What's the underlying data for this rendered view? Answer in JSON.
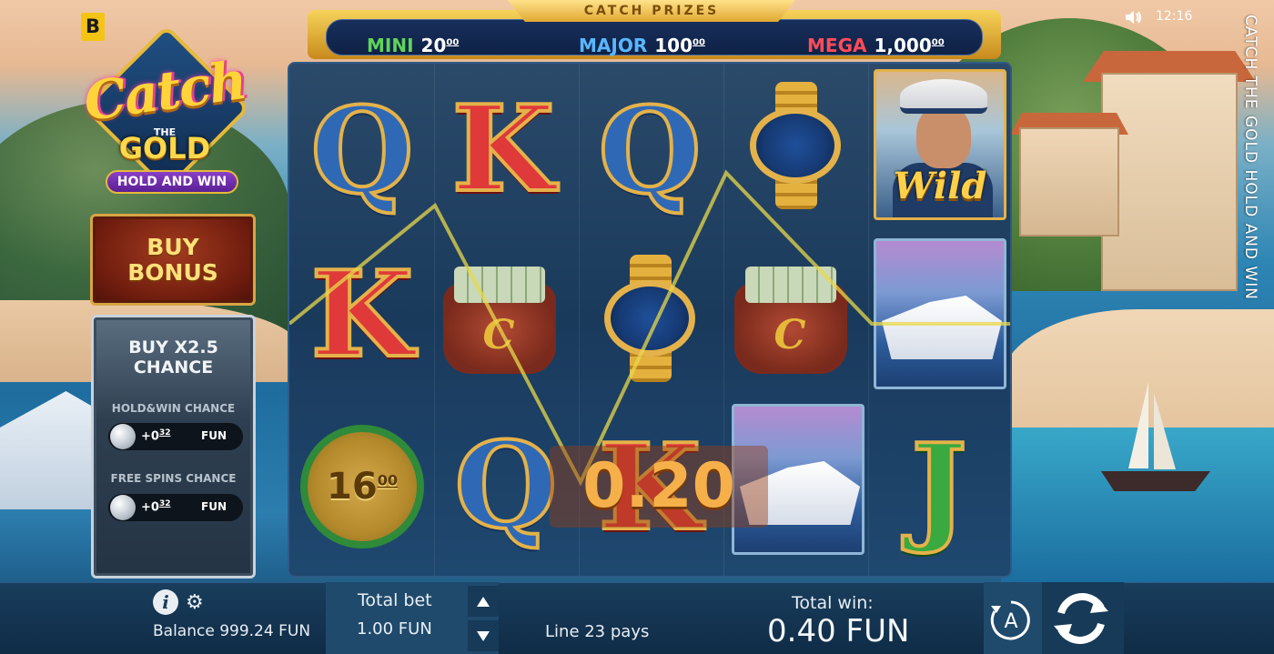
{
  "brand_badge": "B",
  "logo": {
    "catch": "Catch",
    "the": "THE",
    "gold": "GOLD",
    "subtitle": "HOLD AND WIN"
  },
  "buy_bonus": {
    "line1": "BUY",
    "line2": "BONUS"
  },
  "chance_panel": {
    "title_line1": "BUY X2.5",
    "title_line2": "CHANCE",
    "hold_win_label": "HOLD&WIN CHANCE",
    "hold_win_amount": "+0",
    "hold_win_cents": "32",
    "hold_win_currency": "FUN",
    "free_spins_label": "FREE SPINS CHANCE",
    "free_spins_amount": "+0",
    "free_spins_cents": "32",
    "free_spins_currency": "FUN"
  },
  "prize_bar": {
    "title": "CATCH PRIZES",
    "mini": {
      "label": "MINI",
      "amount": "20",
      "cents": "00",
      "color": "#5fd45a"
    },
    "major": {
      "label": "MAJOR",
      "amount": "100",
      "cents": "00",
      "color": "#5ab6ff"
    },
    "mega": {
      "label": "MEGA",
      "amount": "1,000",
      "cents": "00",
      "color": "#ff4b5a"
    }
  },
  "reels": {
    "coin_value": "16",
    "coin_cents": "00",
    "wild_label": "Wild",
    "win_on_reels": "0.20",
    "symbols": [
      [
        "Q",
        "K",
        "coin-16.00"
      ],
      [
        "K",
        "cash-bag",
        "Q"
      ],
      [
        "Q",
        "gold-watch",
        "K"
      ],
      [
        "gold-watch",
        "cash-bag",
        "yacht"
      ],
      [
        "captain-wild",
        "yacht",
        "J"
      ]
    ]
  },
  "status": {
    "time": "12:16",
    "sound_icon": "speaker-icon"
  },
  "vertical_title": "CATCH THE GOLD HOLD AND WIN",
  "bottom_bar": {
    "balance": "Balance 999.24 FUN",
    "total_bet_label": "Total bet",
    "total_bet_value": "1.00 FUN",
    "line_pays": "Line 23 pays",
    "total_win_label": "Total win:",
    "total_win_value": "0.40 FUN",
    "info_glyph": "i",
    "settings_glyph": "⚙"
  },
  "colors": {
    "accent_gold": "#e4b24a",
    "bar_bg": "#193d5c",
    "win_orange": "#f6b04a"
  }
}
